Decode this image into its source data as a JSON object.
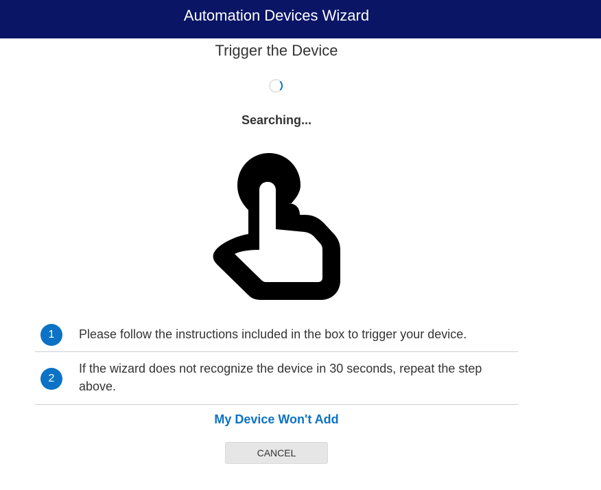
{
  "header": {
    "title": "Automation Devices Wizard",
    "background_color": "#0a1566"
  },
  "step": {
    "title": "Trigger the Device",
    "status_text": "Searching...",
    "illustration_icon": "hand-tap-icon"
  },
  "instructions": [
    {
      "number": "1",
      "text": "Please follow the instructions included in the box to trigger your device."
    },
    {
      "number": "2",
      "text": "If the wizard does not recognize the device in 30 seconds, repeat the step above."
    }
  ],
  "help_link": {
    "label": "My Device Won't Add"
  },
  "actions": {
    "cancel_label": "CANCEL"
  },
  "colors": {
    "accent": "#0b72c6",
    "text": "#333333",
    "button_bg": "#e6e6e6"
  }
}
